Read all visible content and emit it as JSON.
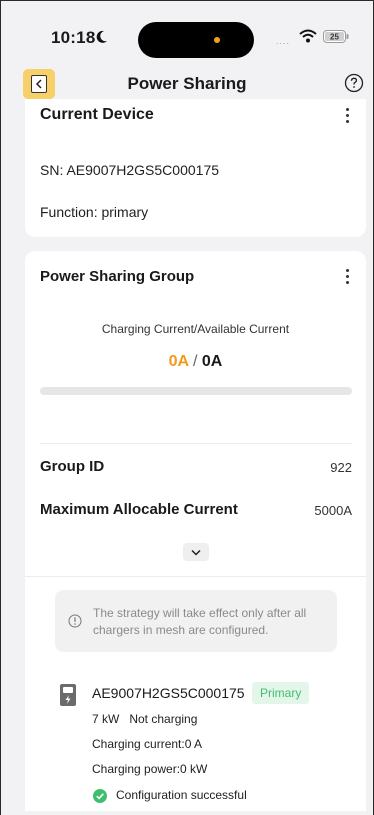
{
  "status_bar": {
    "time": "10:18",
    "signal": "....",
    "battery_level": "25"
  },
  "nav": {
    "title": "Power Sharing"
  },
  "current_device": {
    "title": "Current Device",
    "sn_line": "SN: AE9007H2GS5C000175",
    "function_line": "Function: primary"
  },
  "group": {
    "title": "Power Sharing Group",
    "current_label": "Charging Current/Available Current",
    "charging_current": "0A",
    "separator": "/",
    "available_current": "0A",
    "progress_fraction": 0,
    "group_id_label": "Group ID",
    "group_id_value": "922",
    "max_current_label": "Maximum Allocable Current",
    "max_current_value": "5000A",
    "notice": "The strategy will take effect only after all chargers in mesh are configured."
  },
  "charger": {
    "sn": "AE9007H2GS5C000175",
    "role": "Primary",
    "status_line": "7 kW   Not charging",
    "charging_current": "Charging current:0  A",
    "charging_power": "Charging power:0 kW",
    "config_status": "Configuration successful"
  },
  "colors": {
    "accent": "#f39a1b",
    "success": "#3fbf6e",
    "badge_bg": "#e4f6e9",
    "highlight": "#f8d06a"
  }
}
